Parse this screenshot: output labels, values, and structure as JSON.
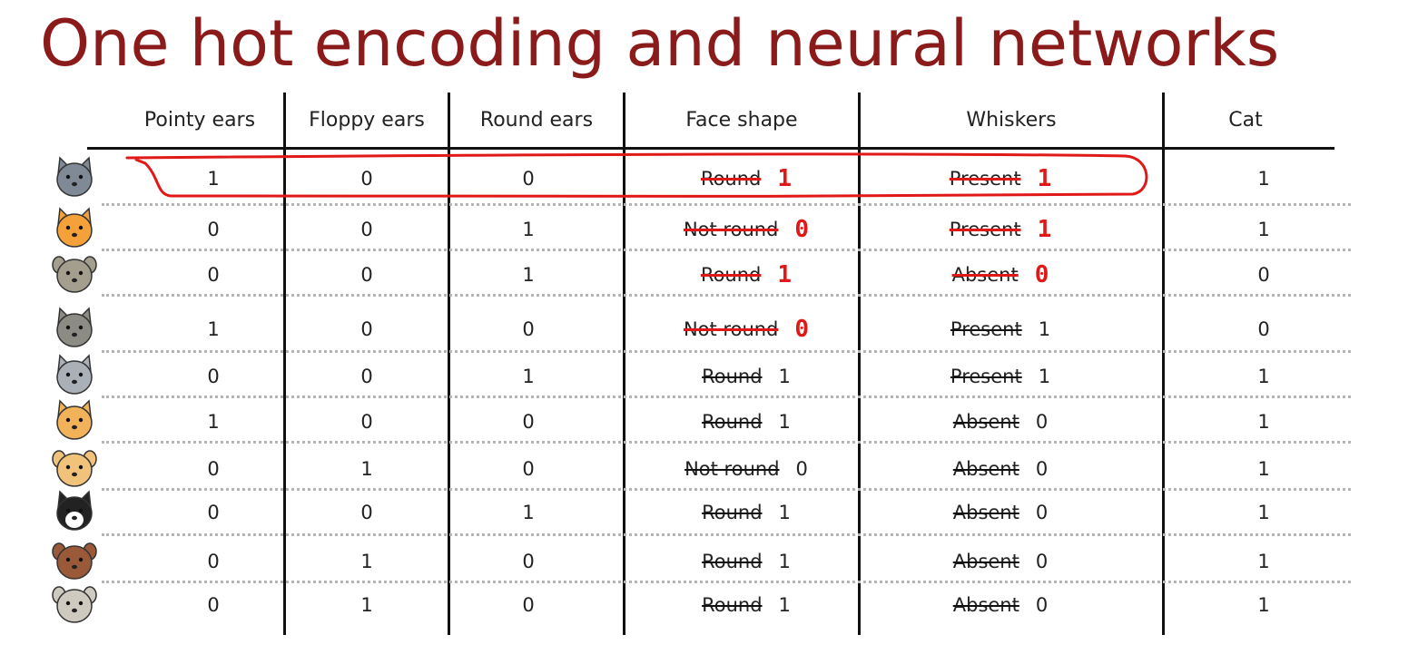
{
  "title": "One hot encoding and neural networks",
  "columns": [
    "Pointy ears",
    "Floppy ears",
    "Round ears",
    "Face shape",
    "Whiskers",
    "Cat"
  ],
  "rows": [
    {
      "animal": "cat-grey-icon",
      "pointy": "1",
      "floppy": "0",
      "round": "0",
      "face_word": "Round",
      "face_num": "1",
      "face_annotated": true,
      "whisk_word": "Present",
      "whisk_num": "1",
      "whisk_annotated": true,
      "cat": "1"
    },
    {
      "animal": "cat-orange-icon",
      "pointy": "0",
      "floppy": "0",
      "round": "1",
      "face_word": "Not round",
      "face_num": "0",
      "face_annotated": true,
      "whisk_word": "Present",
      "whisk_num": "1",
      "whisk_annotated": true,
      "cat": "1"
    },
    {
      "animal": "dog-grey-round-icon",
      "pointy": "0",
      "floppy": "0",
      "round": "1",
      "face_word": "Round",
      "face_num": "1",
      "face_annotated": true,
      "whisk_word": "Absent",
      "whisk_num": "0",
      "whisk_annotated": true,
      "cat": "0"
    },
    {
      "animal": "wolf-icon",
      "pointy": "1",
      "floppy": "0",
      "round": "0",
      "face_word": "Not round",
      "face_num": "0",
      "face_annotated": true,
      "whisk_word": "Present",
      "whisk_num": "1",
      "whisk_annotated": false,
      "cat": "0"
    },
    {
      "animal": "cat-light-grey-icon",
      "pointy": "0",
      "floppy": "0",
      "round": "1",
      "face_word": "Round",
      "face_num": "1",
      "face_annotated": false,
      "whisk_word": "Present",
      "whisk_num": "1",
      "whisk_annotated": false,
      "cat": "1"
    },
    {
      "animal": "cat-orange-white-icon",
      "pointy": "1",
      "floppy": "0",
      "round": "0",
      "face_word": "Round",
      "face_num": "1",
      "face_annotated": false,
      "whisk_word": "Absent",
      "whisk_num": "0",
      "whisk_annotated": false,
      "cat": "1"
    },
    {
      "animal": "dog-tan-icon",
      "pointy": "0",
      "floppy": "1",
      "round": "0",
      "face_word": "Not round",
      "face_num": "0",
      "face_annotated": false,
      "whisk_word": "Absent",
      "whisk_num": "0",
      "whisk_annotated": false,
      "cat": "1"
    },
    {
      "animal": "cat-tuxedo-icon",
      "pointy": "0",
      "floppy": "0",
      "round": "1",
      "face_word": "Round",
      "face_num": "1",
      "face_annotated": false,
      "whisk_word": "Absent",
      "whisk_num": "0",
      "whisk_annotated": false,
      "cat": "1"
    },
    {
      "animal": "dog-brown-icon",
      "pointy": "0",
      "floppy": "1",
      "round": "0",
      "face_word": "Round",
      "face_num": "1",
      "face_annotated": false,
      "whisk_word": "Absent",
      "whisk_num": "0",
      "whisk_annotated": false,
      "cat": "1"
    },
    {
      "animal": "dog-pug-icon",
      "pointy": "0",
      "floppy": "1",
      "round": "0",
      "face_word": "Round",
      "face_num": "1",
      "face_annotated": false,
      "whisk_word": "Absent",
      "whisk_num": "0",
      "whisk_annotated": false,
      "cat": "1"
    }
  ],
  "colors": {
    "title": "#8b1a1a",
    "annotation": "#e01818",
    "text": "#222222",
    "rule": "#111111",
    "dotted": "#b5b5b5"
  }
}
